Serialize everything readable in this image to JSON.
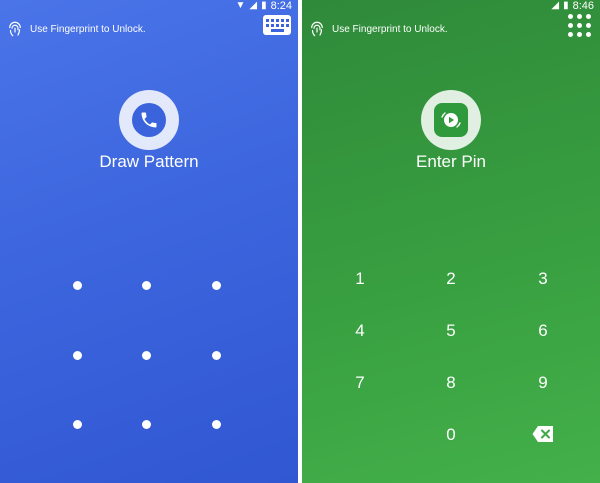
{
  "left_panel": {
    "status": {
      "time": "8:24"
    },
    "hint": "Use Fingerprint to Unlock.",
    "title": "Draw Pattern",
    "pattern_dots": 9,
    "colors": {
      "accent": "#3a63dc"
    },
    "icons": {
      "status": [
        "wifi-icon",
        "signal-icon",
        "battery-icon"
      ],
      "corner": "keyboard-icon",
      "app": "phone-icon",
      "hint": "fingerprint-icon"
    }
  },
  "right_panel": {
    "status": {
      "time": "8:46"
    },
    "hint": "Use Fingerprint to Unlock.",
    "title": "Enter Pin",
    "keypad": [
      "1",
      "2",
      "3",
      "4",
      "5",
      "6",
      "7",
      "8",
      "9",
      "0"
    ],
    "colors": {
      "accent": "#389f40"
    },
    "icons": {
      "status": [
        "signal-icon",
        "battery-icon"
      ],
      "corner": "grid-dots-icon",
      "app": "video-play-icon",
      "hint": "fingerprint-icon",
      "delete": "backspace-icon"
    }
  }
}
